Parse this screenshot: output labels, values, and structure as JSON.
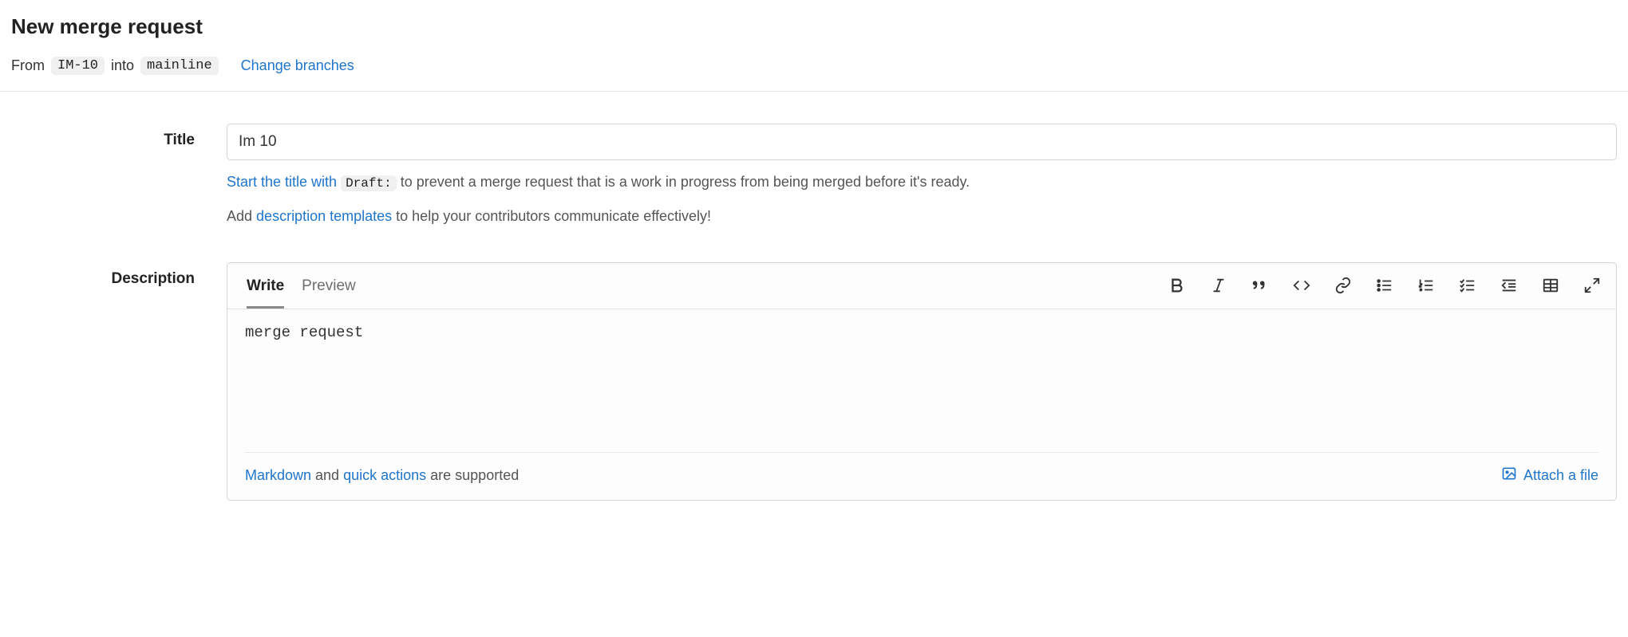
{
  "page": {
    "title": "New merge request"
  },
  "branches": {
    "from_label": "From",
    "source_branch": "IM-10",
    "into_label": "into",
    "target_branch": "mainline",
    "change_link": "Change branches"
  },
  "form": {
    "title_label": "Title",
    "title_value": "Im 10",
    "hint_draft_link": "Start the title with",
    "hint_draft_code": "Draft:",
    "hint_draft_rest": "to prevent a merge request that is a work in progress from being merged before it's ready.",
    "hint_templates_prefix": "Add",
    "hint_templates_link": "description templates",
    "hint_templates_rest": "to help your contributors communicate effectively!",
    "description_label": "Description"
  },
  "editor": {
    "tabs": {
      "write": "Write",
      "preview": "Preview"
    },
    "content": "merge request",
    "footer": {
      "markdown_link": "Markdown",
      "and_text": " and ",
      "quick_actions_link": "quick actions",
      "supported_text": " are supported",
      "attach_label": "Attach a file"
    },
    "toolbar_icons": [
      "bold",
      "italic",
      "quote",
      "code",
      "link",
      "bulleted-list",
      "numbered-list",
      "task-list",
      "outdent",
      "table",
      "fullscreen"
    ]
  }
}
